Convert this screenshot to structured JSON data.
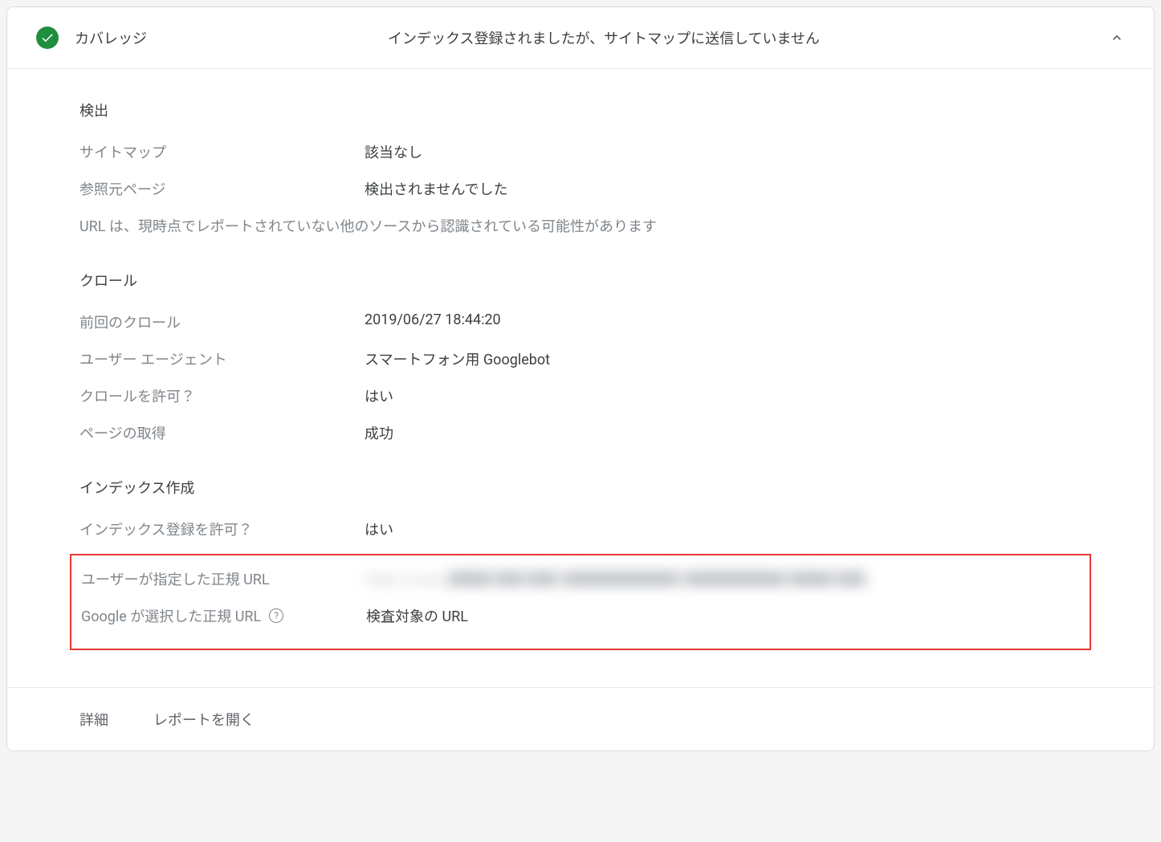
{
  "header": {
    "title": "カバレッジ",
    "status": "インデックス登録されましたが、サイトマップに送信していません"
  },
  "sections": {
    "discovery": {
      "heading": "検出",
      "sitemap_label": "サイトマップ",
      "sitemap_value": "該当なし",
      "referrer_label": "参照元ページ",
      "referrer_value": "検出されませんでした",
      "note": "URL は、現時点でレポートされていない他のソースから認識されている可能性があります"
    },
    "crawl": {
      "heading": "クロール",
      "last_crawl_label": "前回のクロール",
      "last_crawl_value": "2019/06/27 18:44:20",
      "user_agent_label": "ユーザー エージェント",
      "user_agent_value": "スマートフォン用 Googlebot",
      "crawl_allowed_label": "クロールを許可？",
      "crawl_allowed_value": "はい",
      "page_fetch_label": "ページの取得",
      "page_fetch_value": "成功"
    },
    "indexing": {
      "heading": "インデックス作成",
      "indexing_allowed_label": "インデックス登録を許可？",
      "indexing_allowed_value": "はい",
      "user_canonical_label": "ユーザーが指定した正規 URL",
      "user_canonical_value": "https://www.███.██.██/████████/███████ ███ ██",
      "google_canonical_label": "Google が選択した正規 URL",
      "google_canonical_value": "検査対象の URL"
    }
  },
  "footer": {
    "details": "詳細",
    "open_report": "レポートを開く"
  }
}
